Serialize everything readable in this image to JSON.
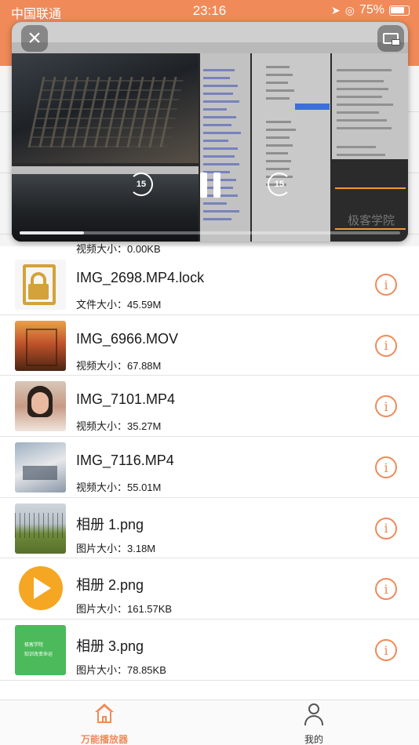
{
  "status_bar": {
    "carrier": "中国联通",
    "time": "23:16",
    "battery": "75%"
  },
  "player": {
    "progress": 0.17,
    "skip_back_seconds": "15",
    "skip_forward_seconds": "15",
    "watermark": "极客学院"
  },
  "first_row": {
    "size": "视频大小：0.00KB"
  },
  "files": [
    {
      "name": "IMG_2698.MP4.lock",
      "size": "文件大小：45.59M",
      "thumb": "lock"
    },
    {
      "name": "IMG_6966.MOV",
      "size": "视频大小：67.88M",
      "thumb": "mov"
    },
    {
      "name": "IMG_7101.MP4",
      "size": "视频大小：35.27M",
      "thumb": "girl"
    },
    {
      "name": "IMG_7116.MP4",
      "size": "视频大小：55.01M",
      "thumb": "room"
    },
    {
      "name": "相册 1.png",
      "size": "图片大小：3.18M",
      "thumb": "field"
    },
    {
      "name": "相册 2.png",
      "size": "图片大小：161.57KB",
      "thumb": "play"
    },
    {
      "name": "相册 3.png",
      "size": "图片大小：78.85KB",
      "thumb": "green"
    }
  ],
  "thumb_green_text": {
    "line1": "极客学院",
    "line2": "知识改变命运"
  },
  "info_glyph": "i",
  "tabbar": {
    "home_label": "万能播放器",
    "me_label": "我的"
  },
  "colors": {
    "accent": "#f08a58"
  }
}
